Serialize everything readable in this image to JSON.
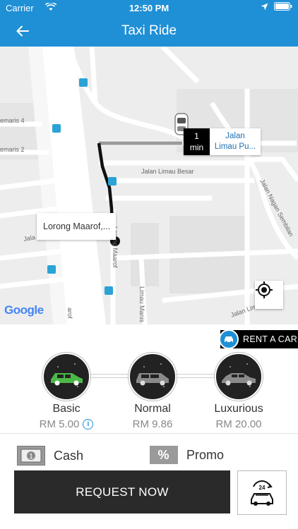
{
  "status_bar": {
    "carrier": "Carrier",
    "time": "12:50 PM"
  },
  "header": {
    "title": "Taxi Ride"
  },
  "map": {
    "street_labels": [
      "Jalan Limau Besar",
      "Jalan Nagan Sembilan",
      "Lorong Maarof",
      "Limau Manis",
      "emaris 4",
      "emaris 2",
      "Jalan Limau",
      "arof",
      "Jala"
    ],
    "google_logo": "Google",
    "destination_popup": {
      "eta_value": "1",
      "eta_unit": "min",
      "address_line1": "Jalan",
      "address_line2": "Limau Pu..."
    },
    "source_popup": {
      "address": "Lorong Maarof,..."
    }
  },
  "rent_a_car": {
    "label": "RENT A CAR"
  },
  "ride_options": [
    {
      "name": "Basic",
      "price": "RM 5.00",
      "selected": true,
      "car_color": "#4cb848"
    },
    {
      "name": "Normal",
      "price": "RM 9.86",
      "selected": false,
      "car_color": "#8a8a8a"
    },
    {
      "name": "Luxurious",
      "price": "RM 20.00",
      "selected": false,
      "car_color": "#8a8a8a"
    }
  ],
  "payment": {
    "method": "Cash",
    "promo": "Promo",
    "promo_icon_text": "%"
  },
  "actions": {
    "request_label": "REQUEST NOW",
    "badge_text": "24"
  },
  "colors": {
    "brand": "#1f8fd6",
    "dark": "#2a2a2a",
    "selected_car": "#4cb848"
  }
}
